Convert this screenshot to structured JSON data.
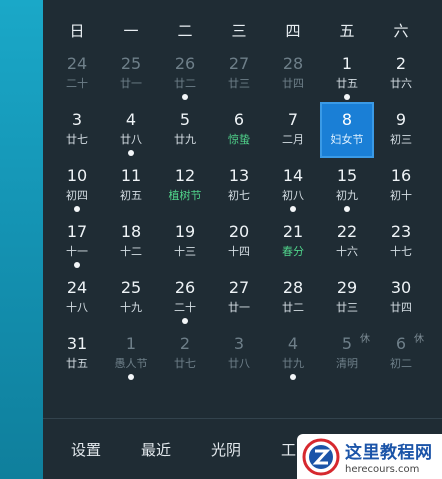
{
  "weekdays": [
    "日",
    "一",
    "二",
    "三",
    "四",
    "五",
    "六"
  ],
  "weeks": [
    [
      {
        "day": "24",
        "lunar": "二十",
        "dim": true
      },
      {
        "day": "25",
        "lunar": "廿一",
        "dim": true
      },
      {
        "day": "26",
        "lunar": "廿二",
        "dim": true,
        "dot": true
      },
      {
        "day": "27",
        "lunar": "廿三",
        "dim": true
      },
      {
        "day": "28",
        "lunar": "廿四",
        "dim": true
      },
      {
        "day": "1",
        "lunar": "廿五",
        "dot": true
      },
      {
        "day": "2",
        "lunar": "廿六"
      }
    ],
    [
      {
        "day": "3",
        "lunar": "廿七"
      },
      {
        "day": "4",
        "lunar": "廿八",
        "dot": true
      },
      {
        "day": "5",
        "lunar": "廿九"
      },
      {
        "day": "6",
        "lunar": "惊蛰",
        "festival": true
      },
      {
        "day": "7",
        "lunar": "二月"
      },
      {
        "day": "8",
        "lunar": "妇女节",
        "selected": true
      },
      {
        "day": "9",
        "lunar": "初三"
      }
    ],
    [
      {
        "day": "10",
        "lunar": "初四",
        "dot": true
      },
      {
        "day": "11",
        "lunar": "初五"
      },
      {
        "day": "12",
        "lunar": "植树节",
        "festival": true
      },
      {
        "day": "13",
        "lunar": "初七"
      },
      {
        "day": "14",
        "lunar": "初八",
        "dot": true
      },
      {
        "day": "15",
        "lunar": "初九",
        "dot": true
      },
      {
        "day": "16",
        "lunar": "初十"
      }
    ],
    [
      {
        "day": "17",
        "lunar": "十一",
        "dot": true
      },
      {
        "day": "18",
        "lunar": "十二"
      },
      {
        "day": "19",
        "lunar": "十三"
      },
      {
        "day": "20",
        "lunar": "十四"
      },
      {
        "day": "21",
        "lunar": "春分",
        "festival": true
      },
      {
        "day": "22",
        "lunar": "十六"
      },
      {
        "day": "23",
        "lunar": "十七"
      }
    ],
    [
      {
        "day": "24",
        "lunar": "十八"
      },
      {
        "day": "25",
        "lunar": "十九"
      },
      {
        "day": "26",
        "lunar": "二十",
        "dot": true
      },
      {
        "day": "27",
        "lunar": "廿一"
      },
      {
        "day": "28",
        "lunar": "廿二"
      },
      {
        "day": "29",
        "lunar": "廿三"
      },
      {
        "day": "30",
        "lunar": "廿四"
      }
    ],
    [
      {
        "day": "31",
        "lunar": "廿五"
      },
      {
        "day": "1",
        "lunar": "愚人节",
        "dim": true,
        "dot": true
      },
      {
        "day": "2",
        "lunar": "廿七",
        "dim": true
      },
      {
        "day": "3",
        "lunar": "廿八",
        "dim": true
      },
      {
        "day": "4",
        "lunar": "廿九",
        "dim": true,
        "dot": true
      },
      {
        "day": "5",
        "lunar": "清明",
        "dim": true,
        "rest": "休"
      },
      {
        "day": "6",
        "lunar": "初二",
        "dim": true,
        "rest": "休"
      }
    ]
  ],
  "bottom_bar": {
    "items": [
      "设置",
      "最近",
      "光阴",
      "工"
    ]
  },
  "watermark": {
    "title": "这里教程网",
    "url": "herecours.com"
  },
  "colors": {
    "panel_bg": "#1f2c34",
    "selected_bg": "#1a7fd6",
    "festival": "#4fd28a",
    "accent_strip": "#1492b2"
  }
}
